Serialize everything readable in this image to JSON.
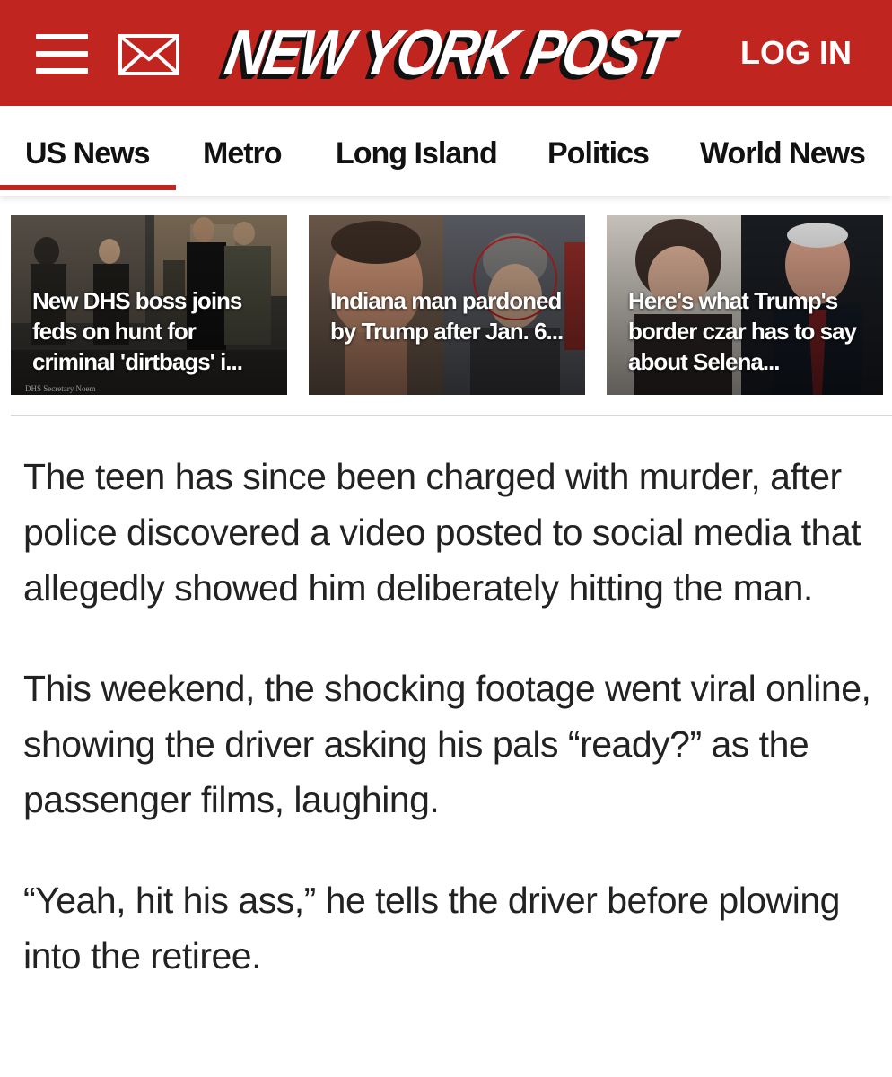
{
  "header": {
    "logo_text": "NEW YORK POST",
    "login_label": "LOG IN",
    "menu_icon": "hamburger-menu-icon",
    "mail_icon": "envelope-icon",
    "bg_color": "#c0251f"
  },
  "nav": {
    "items": [
      {
        "label": "US News",
        "active": true
      },
      {
        "label": "Metro",
        "active": false
      },
      {
        "label": "Long Island",
        "active": false
      },
      {
        "label": "Politics",
        "active": false
      },
      {
        "label": "World News",
        "active": false
      }
    ],
    "accent_color": "#c0251f"
  },
  "cards": [
    {
      "headline": "New DHS boss joins feds on hunt for criminal 'dirtbags' i...",
      "credit": "DHS Secretary Noem"
    },
    {
      "headline": "Indiana man pardoned by Trump after Jan. 6...",
      "credit": ""
    },
    {
      "headline": "Here's what Trump's border czar has to say about Selena...",
      "credit": ""
    }
  ],
  "article": {
    "paragraphs": [
      "The teen has since been charged with murder, after police discovered a video posted to social media that allegedly showed him deliberately hitting the man.",
      "This weekend, the shocking footage went viral online, showing the driver asking his pals “ready?” as the passenger films, laughing.",
      "“Yeah, hit his ass,” he tells the driver before plowing into the retiree."
    ]
  }
}
